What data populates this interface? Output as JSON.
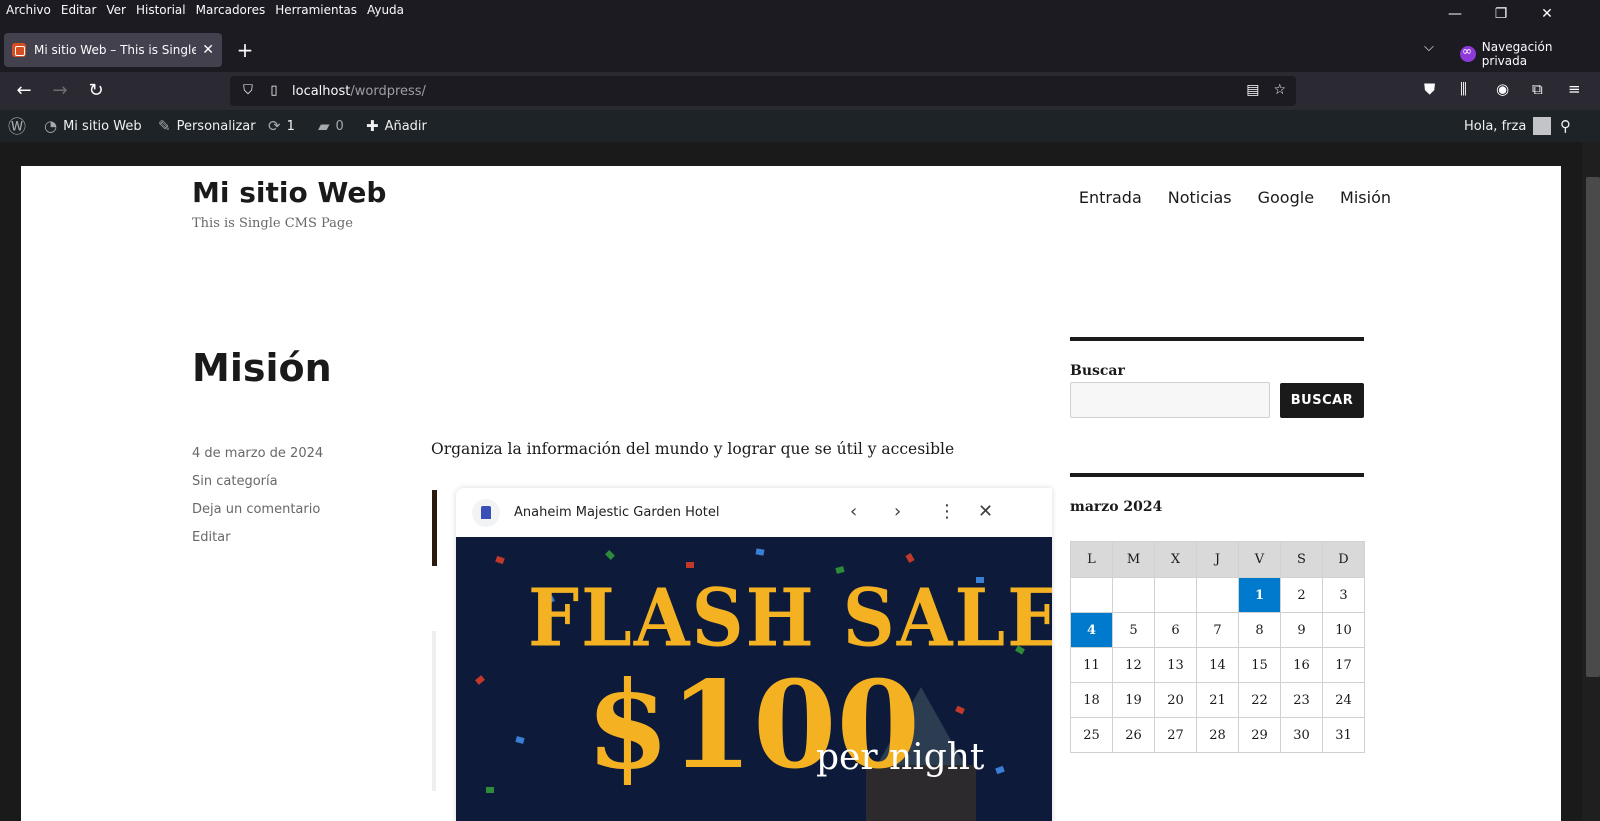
{
  "browser": {
    "menus": [
      "Archivo",
      "Editar",
      "Ver",
      "Historial",
      "Marcadores",
      "Herramientas",
      "Ayuda"
    ],
    "tab_title": "Mi sitio Web – This is Single CMS",
    "private_label": "Navegación privada",
    "url_host": "localhost",
    "url_path": "/wordpress/"
  },
  "adminbar": {
    "site_name": "Mi sitio Web",
    "customize": "Personalizar",
    "updates_count": "1",
    "comments_count": "0",
    "add_new": "Añadir",
    "greeting": "Hola, frza"
  },
  "site": {
    "title": "Mi sitio Web",
    "description": "This is Single CMS Page",
    "nav": [
      "Entrada",
      "Noticias",
      "Google",
      "Misión"
    ]
  },
  "post": {
    "title": "Misión",
    "date": "4 de marzo de 2024",
    "category": "Sin categoría",
    "comment_link": "Deja un comentario",
    "edit_link": "Editar",
    "content": "Organiza la información del mundo y lograr que se útil y accesible"
  },
  "embed": {
    "hotel_name": "Anaheim Majestic Garden Hotel",
    "headline": "FLASH SALE",
    "price": "$100",
    "per": "per night"
  },
  "sidebar": {
    "search_title": "Buscar",
    "search_button": "BUSCAR",
    "calendar_caption": "marzo 2024",
    "weekdays": [
      "L",
      "M",
      "X",
      "J",
      "V",
      "S",
      "D"
    ],
    "weeks": [
      [
        "",
        "",
        "",
        "",
        "1",
        "2",
        "3"
      ],
      [
        "4",
        "5",
        "6",
        "7",
        "8",
        "9",
        "10"
      ],
      [
        "11",
        "12",
        "13",
        "14",
        "15",
        "16",
        "17"
      ],
      [
        "18",
        "19",
        "20",
        "21",
        "22",
        "23",
        "24"
      ],
      [
        "25",
        "26",
        "27",
        "28",
        "29",
        "30",
        "31"
      ]
    ],
    "linked_days": [
      "1",
      "4"
    ],
    "link_color": "#007acc"
  }
}
